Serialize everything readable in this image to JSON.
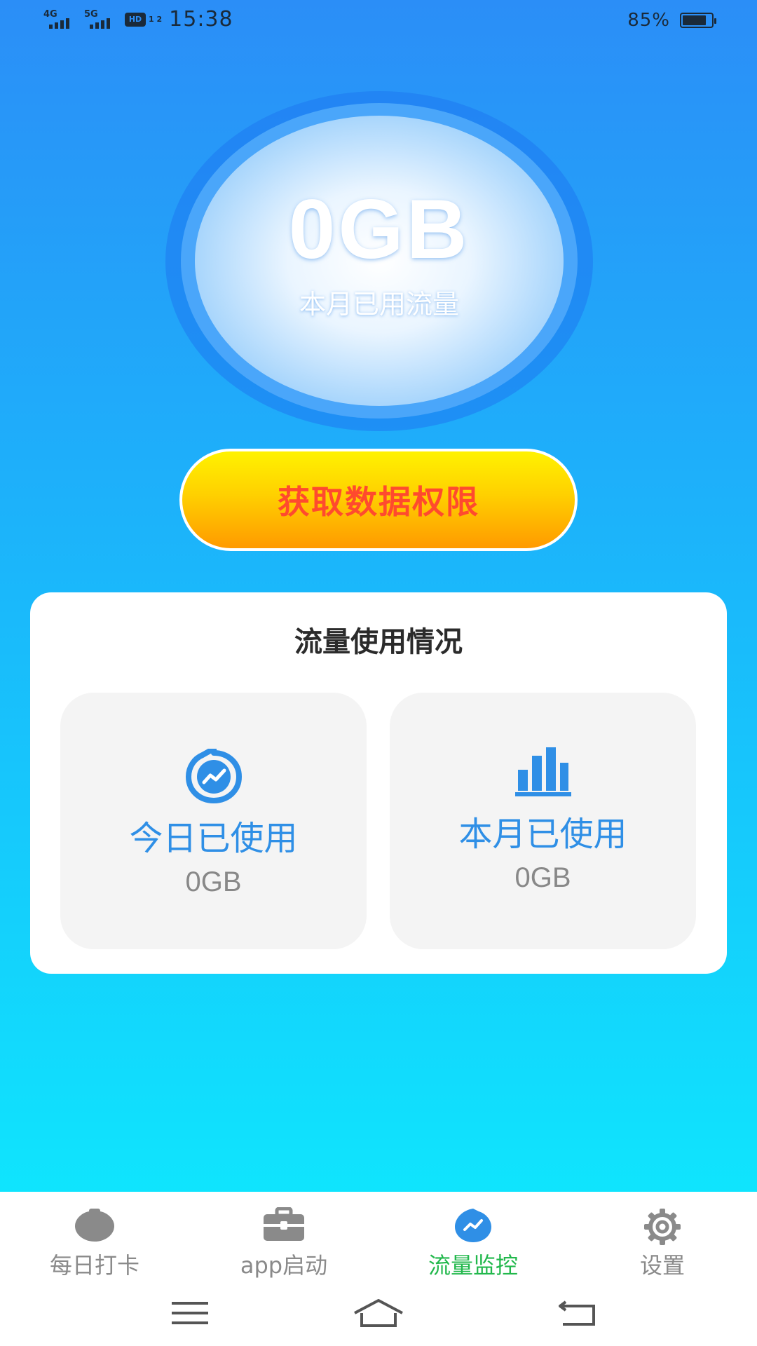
{
  "status_bar": {
    "network_1": "4G",
    "network_2": "5G",
    "hd_badge": "HD",
    "hd_sub": "1 2",
    "time": "15:38",
    "battery_percent": "85%",
    "battery_level": 0.85
  },
  "summary": {
    "value": "0GB",
    "caption": "本月已用流量"
  },
  "permission_button": {
    "label": "获取数据权限"
  },
  "usage_card": {
    "title": "流量使用情况",
    "today": {
      "icon": "trend-drop-icon",
      "label": "今日已使用",
      "value": "0GB"
    },
    "month": {
      "icon": "bar-chart-icon",
      "label": "本月已使用",
      "value": "0GB"
    }
  },
  "tabs": [
    {
      "label": "每日打卡",
      "icon": "gray-blob-icon",
      "active": false
    },
    {
      "label": "app启动",
      "icon": "briefcase-icon",
      "active": false
    },
    {
      "label": "流量监控",
      "icon": "trend-drop-icon",
      "active": true
    },
    {
      "label": "设置",
      "icon": "gear-icon",
      "active": false
    }
  ],
  "colors": {
    "accent_blue": "#2f8fe6",
    "active_tab": "#22b84c",
    "button_text": "#ff4a2e"
  }
}
